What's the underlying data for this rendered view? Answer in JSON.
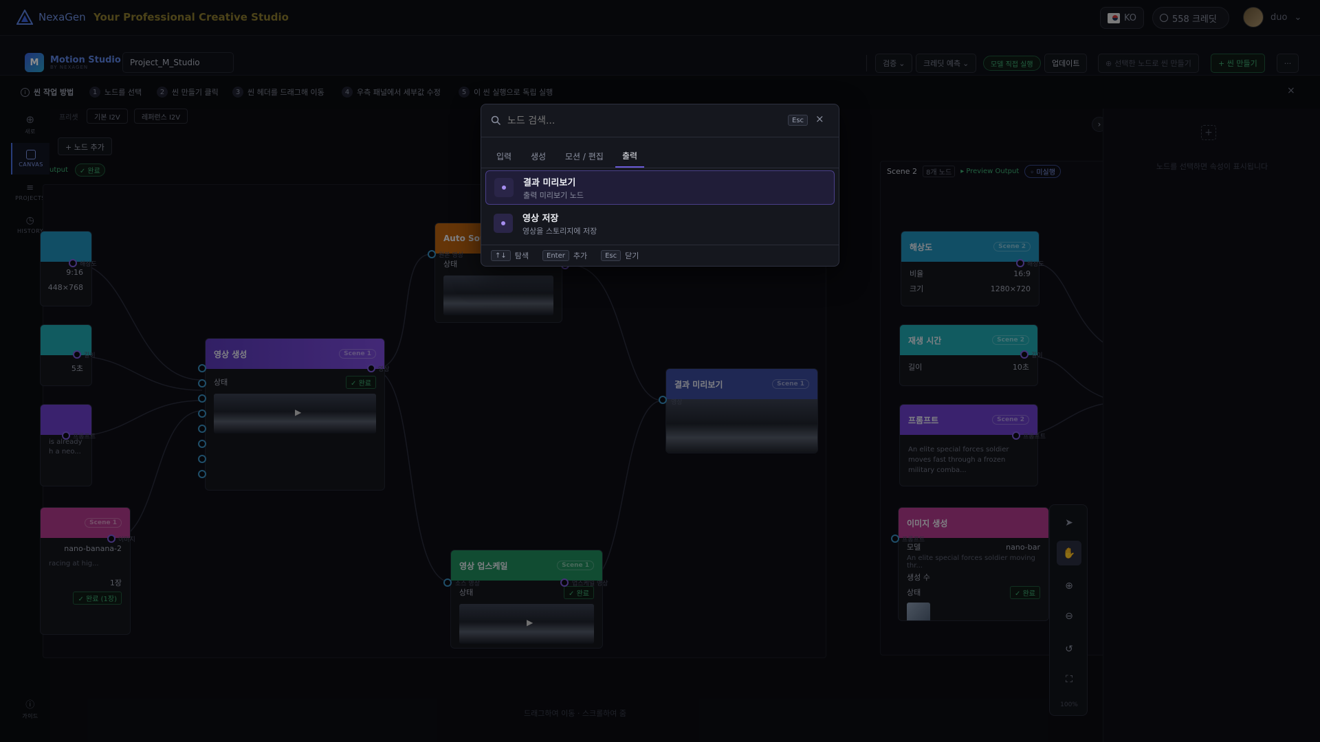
{
  "topbar": {
    "brand": "NexaGen",
    "tagline": "Your Professional Creative Studio",
    "language": "KO",
    "credits": "558 크레딧",
    "user": "duo"
  },
  "studio": {
    "app_name": "Motion Studio",
    "app_sub": "BY NEXAGEN",
    "project_name": "Project_M_Studio",
    "buttons": {
      "verify": "검증",
      "credit_estimate": "크레딧 예측",
      "model_direct_run": "모델 직접 실행",
      "update": "업데이트",
      "make_scene_from_selection": "선택한 노드로 씬 만들기",
      "new_scene": "+ 씬 만들기",
      "more": "···"
    }
  },
  "guide": {
    "title": "씬 작업 방법",
    "steps": [
      {
        "num": "1",
        "text": "노드를 선택"
      },
      {
        "num": "2",
        "text": "씬 만들기 클릭"
      },
      {
        "num": "3",
        "text": "씬 헤더를 드래그해 이동"
      },
      {
        "num": "4",
        "text": "우측 패널에서 세부값 수정"
      },
      {
        "num": "5",
        "text": "이 씬 실행으로 독립 실행"
      }
    ]
  },
  "sidebar": {
    "items": [
      {
        "label": "새로"
      },
      {
        "label": "CANVAS"
      },
      {
        "label": "PROJECTS"
      },
      {
        "label": "HISTORY"
      },
      {
        "label": "가이드"
      }
    ]
  },
  "canvas": {
    "preset_label": "프리셋",
    "presets": [
      "기본 I2V",
      "레퍼런스 I2V"
    ],
    "add_node": "+ 노드 추가",
    "scene1_header": {
      "output": "utput",
      "status": "✓ 완료"
    },
    "scene2_header": {
      "name": "Scene 2",
      "count": "8개 노드",
      "preview": "▸ Preview Output",
      "status": "◦ 미실행"
    },
    "bottom_hint": "드래그하여 이동 · 스크롤하여 줌",
    "zoom": "100%",
    "left_nodes": {
      "res": {
        "value": "9:16",
        "size": "448×768",
        "port": "해상도"
      },
      "dur": {
        "value": "5초",
        "port": "길이"
      },
      "prompt": {
        "text": "is already",
        "text2": "h a neo...",
        "port": "프롬프트"
      },
      "img": {
        "model": "nano-banana-2",
        "desc": "racing at hig...",
        "count": "1장",
        "status": "✓ 완료 (1장)",
        "badge": "Scene 1",
        "port": "이미지"
      }
    },
    "video_gen": {
      "title": "영상 생성",
      "badge": "Scene 1",
      "status_label": "상태",
      "status": "✓ 완료",
      "out_port": "영상"
    },
    "auto_sound": {
      "title": "Auto Soun",
      "in_port": "원본 영상",
      "status_label": "상태"
    },
    "upscale": {
      "title": "영상 업스케일",
      "badge": "Scene 1",
      "in_port": "소스 영상",
      "out_port": "업스케일 영상",
      "status_label": "상태",
      "status": "✓ 완료"
    },
    "preview": {
      "title": "결과 미리보기",
      "badge": "Scene 1",
      "port": "영상"
    },
    "s2_res": {
      "title": "해상도",
      "badge": "Scene 2",
      "ratio_label": "비율",
      "ratio": "16:9",
      "size_label": "크기",
      "size": "1280×720",
      "port": "해상도"
    },
    "s2_dur": {
      "title": "재생 시간",
      "badge": "Scene 2",
      "len_label": "길이",
      "len": "10초",
      "port": "길이"
    },
    "s2_prompt": {
      "title": "프롬프트",
      "badge": "Scene 2",
      "text": "An elite special forces soldier moves fast through a frozen military comba...",
      "port": "프롬프트"
    },
    "s2_img": {
      "title": "이미지 생성",
      "in_port": "프롬프트",
      "model_label": "모델",
      "model": "nano-bar",
      "desc": "An elite special forces soldier moving thr...",
      "count_label": "생성 수",
      "status_label": "상태",
      "status": "✓ 완료"
    }
  },
  "right_panel": {
    "empty_hint": "노드를 선택하면 속성이 표시됩니다"
  },
  "modal": {
    "placeholder": "노드 검색...",
    "esc": "Esc",
    "tabs": [
      "입력",
      "생성",
      "모션 / 편집",
      "출력"
    ],
    "active_tab": "출력",
    "results": [
      {
        "title": "결과 미리보기",
        "desc": "출력 미리보기 노드"
      },
      {
        "title": "영상 저장",
        "desc": "영상을 스토리지에 저장"
      }
    ],
    "footer": {
      "nav_key": "↑↓",
      "nav": "탐색",
      "enter_key": "Enter",
      "enter": "추가",
      "esc_key": "Esc",
      "esc": "닫기"
    }
  },
  "colors": {
    "accent": "#6a5ad8",
    "blue_header": "#1f8fb8",
    "cyan_header": "#1fa6b0",
    "purple_header": "#6b3fc8",
    "pink_header": "#b03a8a",
    "green_header": "#1f8a5c",
    "orange_header": "#b8620f",
    "ok": "#3fae74"
  }
}
